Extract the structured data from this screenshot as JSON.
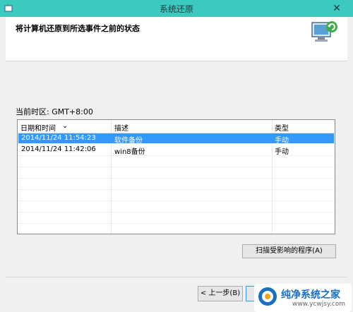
{
  "window": {
    "title": "系统还原",
    "close_glyph": "✕"
  },
  "header": {
    "heading": "将计算机还原到所选事件之前的状态"
  },
  "timezone_label": "当前时区: GMT+8:00",
  "table": {
    "columns": [
      "日期和时间",
      "描述",
      "类型"
    ],
    "rows": [
      {
        "datetime": "2014/11/24 11:54:23",
        "description": "软件备份",
        "type": "手动",
        "selected": true
      },
      {
        "datetime": "2014/11/24 11:42:06",
        "description": "win8备份",
        "type": "手动",
        "selected": false
      }
    ]
  },
  "buttons": {
    "scan": "扫描受影响的程序(A)",
    "back": "< 上一步(B)"
  },
  "watermark": {
    "name": "纯净系统之家",
    "url": "www.ycwjsy.com"
  },
  "colors": {
    "titlebar": "#3cc9bf",
    "selection": "#3399ff",
    "watermark_text": "#1a6fc4"
  }
}
